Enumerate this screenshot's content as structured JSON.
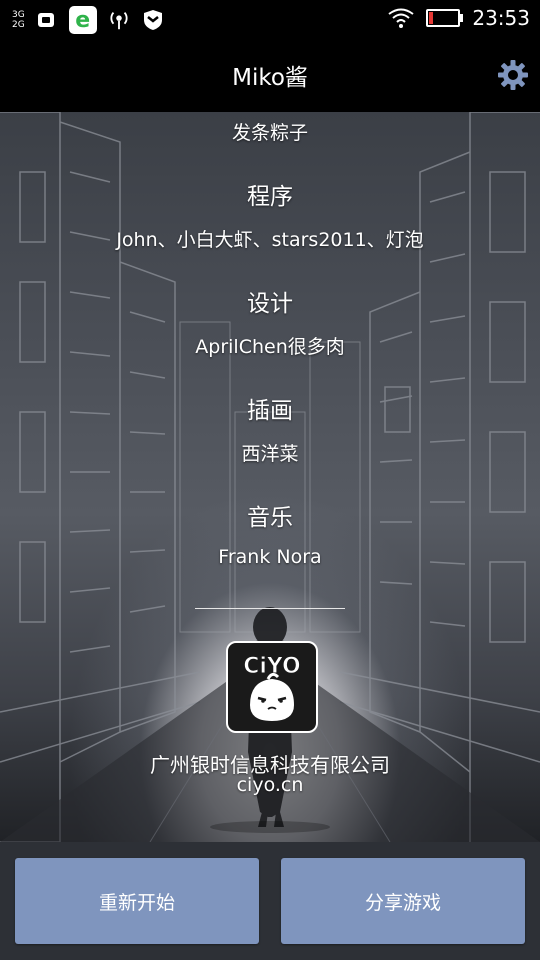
{
  "status_bar": {
    "network_top": "3G",
    "network_bottom": "2G",
    "time": "23:53",
    "icons": [
      "sim-signal-icon",
      "sim-card-icon",
      "e-browser-icon",
      "wireless-icon",
      "shield-icon",
      "wifi-icon",
      "battery-icon"
    ],
    "battery_color": "#e53935"
  },
  "header": {
    "title": "Miko酱",
    "settings_icon": "gear-icon",
    "settings_color": "#7f95be"
  },
  "credits": {
    "publisher_names": "发条粽子",
    "sections": [
      {
        "title": "程序",
        "names": "John、小白大虾、stars2011、灯泡"
      },
      {
        "title": "设计",
        "names": "AprilChen很多肉"
      },
      {
        "title": "插画",
        "names": "西洋菜"
      },
      {
        "title": "音乐",
        "names": "Frank Nora"
      }
    ]
  },
  "company": {
    "logo_text": "CiYO",
    "name": "广州银时信息科技有限公司",
    "site": "ciyo.cn"
  },
  "buttons": {
    "restart_label": "重新开始",
    "share_label": "分享游戏",
    "color": "#7f95be"
  }
}
